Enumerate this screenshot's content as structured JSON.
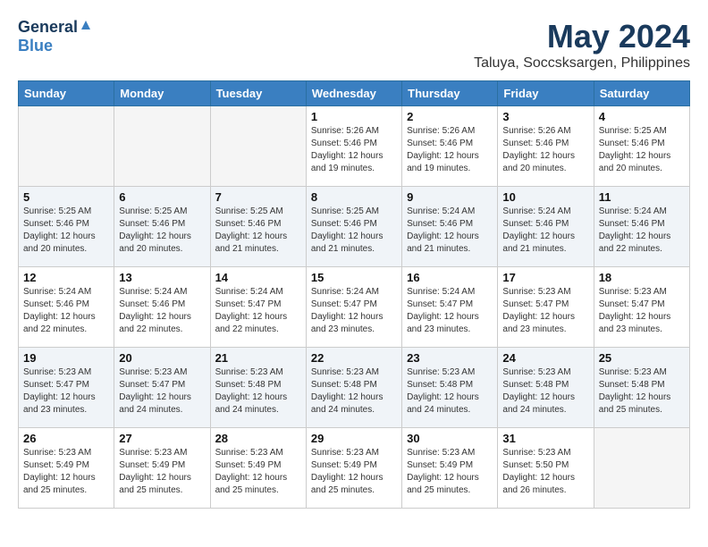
{
  "header": {
    "logo_general": "General",
    "logo_blue": "Blue",
    "main_title": "May 2024",
    "subtitle": "Taluya, Soccsksargen, Philippines"
  },
  "days": [
    "Sunday",
    "Monday",
    "Tuesday",
    "Wednesday",
    "Thursday",
    "Friday",
    "Saturday"
  ],
  "weeks": [
    [
      {
        "date": "",
        "sunrise": "",
        "sunset": "",
        "daylight": ""
      },
      {
        "date": "",
        "sunrise": "",
        "sunset": "",
        "daylight": ""
      },
      {
        "date": "",
        "sunrise": "",
        "sunset": "",
        "daylight": ""
      },
      {
        "date": "1",
        "sunrise": "Sunrise: 5:26 AM",
        "sunset": "Sunset: 5:46 PM",
        "daylight": "Daylight: 12 hours and 19 minutes."
      },
      {
        "date": "2",
        "sunrise": "Sunrise: 5:26 AM",
        "sunset": "Sunset: 5:46 PM",
        "daylight": "Daylight: 12 hours and 19 minutes."
      },
      {
        "date": "3",
        "sunrise": "Sunrise: 5:26 AM",
        "sunset": "Sunset: 5:46 PM",
        "daylight": "Daylight: 12 hours and 20 minutes."
      },
      {
        "date": "4",
        "sunrise": "Sunrise: 5:25 AM",
        "sunset": "Sunset: 5:46 PM",
        "daylight": "Daylight: 12 hours and 20 minutes."
      }
    ],
    [
      {
        "date": "5",
        "sunrise": "Sunrise: 5:25 AM",
        "sunset": "Sunset: 5:46 PM",
        "daylight": "Daylight: 12 hours and 20 minutes."
      },
      {
        "date": "6",
        "sunrise": "Sunrise: 5:25 AM",
        "sunset": "Sunset: 5:46 PM",
        "daylight": "Daylight: 12 hours and 20 minutes."
      },
      {
        "date": "7",
        "sunrise": "Sunrise: 5:25 AM",
        "sunset": "Sunset: 5:46 PM",
        "daylight": "Daylight: 12 hours and 21 minutes."
      },
      {
        "date": "8",
        "sunrise": "Sunrise: 5:25 AM",
        "sunset": "Sunset: 5:46 PM",
        "daylight": "Daylight: 12 hours and 21 minutes."
      },
      {
        "date": "9",
        "sunrise": "Sunrise: 5:24 AM",
        "sunset": "Sunset: 5:46 PM",
        "daylight": "Daylight: 12 hours and 21 minutes."
      },
      {
        "date": "10",
        "sunrise": "Sunrise: 5:24 AM",
        "sunset": "Sunset: 5:46 PM",
        "daylight": "Daylight: 12 hours and 21 minutes."
      },
      {
        "date": "11",
        "sunrise": "Sunrise: 5:24 AM",
        "sunset": "Sunset: 5:46 PM",
        "daylight": "Daylight: 12 hours and 22 minutes."
      }
    ],
    [
      {
        "date": "12",
        "sunrise": "Sunrise: 5:24 AM",
        "sunset": "Sunset: 5:46 PM",
        "daylight": "Daylight: 12 hours and 22 minutes."
      },
      {
        "date": "13",
        "sunrise": "Sunrise: 5:24 AM",
        "sunset": "Sunset: 5:46 PM",
        "daylight": "Daylight: 12 hours and 22 minutes."
      },
      {
        "date": "14",
        "sunrise": "Sunrise: 5:24 AM",
        "sunset": "Sunset: 5:47 PM",
        "daylight": "Daylight: 12 hours and 22 minutes."
      },
      {
        "date": "15",
        "sunrise": "Sunrise: 5:24 AM",
        "sunset": "Sunset: 5:47 PM",
        "daylight": "Daylight: 12 hours and 23 minutes."
      },
      {
        "date": "16",
        "sunrise": "Sunrise: 5:24 AM",
        "sunset": "Sunset: 5:47 PM",
        "daylight": "Daylight: 12 hours and 23 minutes."
      },
      {
        "date": "17",
        "sunrise": "Sunrise: 5:23 AM",
        "sunset": "Sunset: 5:47 PM",
        "daylight": "Daylight: 12 hours and 23 minutes."
      },
      {
        "date": "18",
        "sunrise": "Sunrise: 5:23 AM",
        "sunset": "Sunset: 5:47 PM",
        "daylight": "Daylight: 12 hours and 23 minutes."
      }
    ],
    [
      {
        "date": "19",
        "sunrise": "Sunrise: 5:23 AM",
        "sunset": "Sunset: 5:47 PM",
        "daylight": "Daylight: 12 hours and 23 minutes."
      },
      {
        "date": "20",
        "sunrise": "Sunrise: 5:23 AM",
        "sunset": "Sunset: 5:47 PM",
        "daylight": "Daylight: 12 hours and 24 minutes."
      },
      {
        "date": "21",
        "sunrise": "Sunrise: 5:23 AM",
        "sunset": "Sunset: 5:48 PM",
        "daylight": "Daylight: 12 hours and 24 minutes."
      },
      {
        "date": "22",
        "sunrise": "Sunrise: 5:23 AM",
        "sunset": "Sunset: 5:48 PM",
        "daylight": "Daylight: 12 hours and 24 minutes."
      },
      {
        "date": "23",
        "sunrise": "Sunrise: 5:23 AM",
        "sunset": "Sunset: 5:48 PM",
        "daylight": "Daylight: 12 hours and 24 minutes."
      },
      {
        "date": "24",
        "sunrise": "Sunrise: 5:23 AM",
        "sunset": "Sunset: 5:48 PM",
        "daylight": "Daylight: 12 hours and 24 minutes."
      },
      {
        "date": "25",
        "sunrise": "Sunrise: 5:23 AM",
        "sunset": "Sunset: 5:48 PM",
        "daylight": "Daylight: 12 hours and 25 minutes."
      }
    ],
    [
      {
        "date": "26",
        "sunrise": "Sunrise: 5:23 AM",
        "sunset": "Sunset: 5:49 PM",
        "daylight": "Daylight: 12 hours and 25 minutes."
      },
      {
        "date": "27",
        "sunrise": "Sunrise: 5:23 AM",
        "sunset": "Sunset: 5:49 PM",
        "daylight": "Daylight: 12 hours and 25 minutes."
      },
      {
        "date": "28",
        "sunrise": "Sunrise: 5:23 AM",
        "sunset": "Sunset: 5:49 PM",
        "daylight": "Daylight: 12 hours and 25 minutes."
      },
      {
        "date": "29",
        "sunrise": "Sunrise: 5:23 AM",
        "sunset": "Sunset: 5:49 PM",
        "daylight": "Daylight: 12 hours and 25 minutes."
      },
      {
        "date": "30",
        "sunrise": "Sunrise: 5:23 AM",
        "sunset": "Sunset: 5:49 PM",
        "daylight": "Daylight: 12 hours and 25 minutes."
      },
      {
        "date": "31",
        "sunrise": "Sunrise: 5:23 AM",
        "sunset": "Sunset: 5:50 PM",
        "daylight": "Daylight: 12 hours and 26 minutes."
      },
      {
        "date": "",
        "sunrise": "",
        "sunset": "",
        "daylight": ""
      }
    ]
  ]
}
